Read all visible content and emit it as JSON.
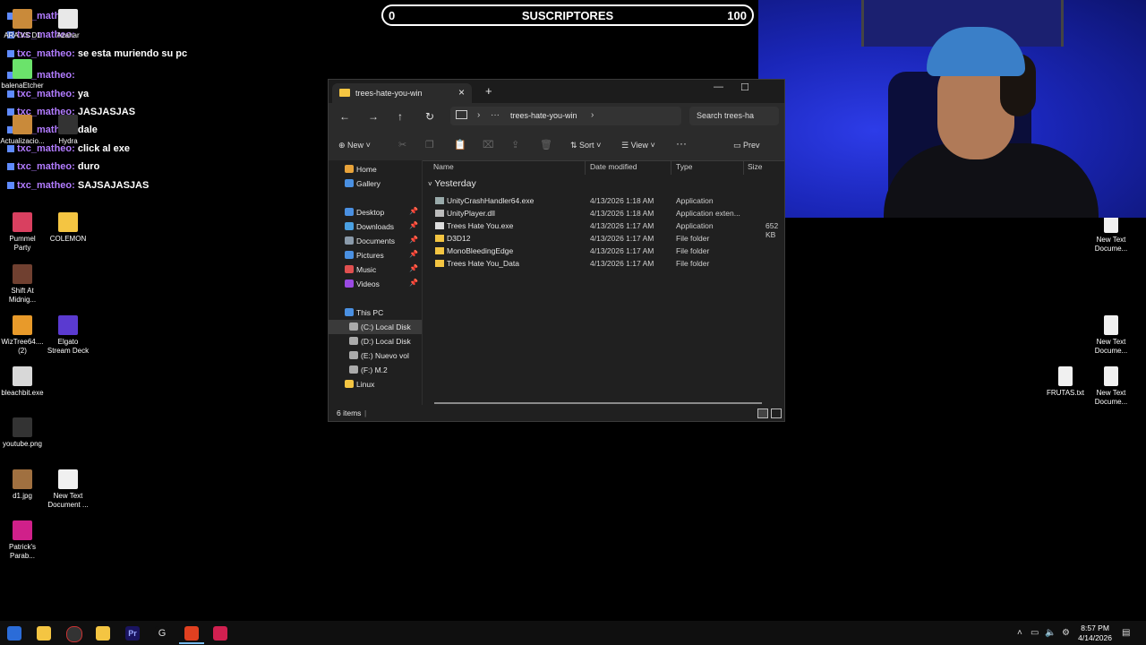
{
  "subscriber_bar": {
    "left_value": "0",
    "label": "SUSCRIPTORES",
    "right_value": "100"
  },
  "chat": [
    {
      "user": "txc_matheo:",
      "message": ""
    },
    {
      "user": "txc_matheo:",
      "message": ""
    },
    {
      "user": "txc_matheo:",
      "message": "se esta muriendo su pc"
    },
    {
      "user": "txc_matheo:",
      "message": ""
    },
    {
      "user": "txc_matheo:",
      "message": "ya"
    },
    {
      "user": "txc_matheo:",
      "message": "JASJASJAS"
    },
    {
      "user": "txc_matheo:",
      "message": "dale"
    },
    {
      "user": "txc_matheo:",
      "message": "click al exe"
    },
    {
      "user": "txc_matheo:",
      "message": "duro"
    },
    {
      "user": "txc_matheo:",
      "message": "SAJSAJASJAS"
    }
  ],
  "desktop_icons_left": [
    {
      "label": "ARA VS D1",
      "icon": "image-icon",
      "color": "#c98a3a"
    },
    {
      "label": "Azahar",
      "icon": "azahar-icon",
      "color": "#e8e8e8"
    },
    {
      "label": "balenaEtcher",
      "icon": "balena-icon",
      "color": "#6be36b"
    },
    {
      "label": "Actualizacio...",
      "icon": "update-icon",
      "color": "#c98a3a"
    },
    {
      "label": "Hydra",
      "icon": "hydra-icon",
      "color": "#333333"
    },
    {
      "label": "Pummel Party",
      "icon": "pummel-icon",
      "color": "#d94060"
    },
    {
      "label": "COLEMON",
      "icon": "folder-icon",
      "color": "#f4c542"
    },
    {
      "label": "Shift At Midnig...",
      "icon": "game-icon",
      "color": "#704030"
    },
    {
      "label": "WizTree64.... (2)",
      "icon": "wiztree-icon",
      "color": "#e89a2a"
    },
    {
      "label": "Elgato Stream Deck",
      "icon": "streamdeck-icon",
      "color": "#5a3ad0"
    },
    {
      "label": "bleachbit.exe",
      "icon": "bleachbit-icon",
      "color": "#d8d8d8"
    },
    {
      "label": "youtube.png",
      "icon": "image-icon",
      "color": "#333333"
    },
    {
      "label": "d1.jpg",
      "icon": "image-icon",
      "color": "#a07040"
    },
    {
      "label": "New Text Document ...",
      "icon": "text-file-icon",
      "color": "#f0f0f0"
    },
    {
      "label": "Patrick's Parab...",
      "icon": "game-icon",
      "color": "#d0208a"
    }
  ],
  "desktop_icons_right": [
    {
      "label": "New Text Docume..."
    },
    {
      "label": "New Text Docume..."
    },
    {
      "label": "FRUTAS.txt"
    },
    {
      "label": "New Text Docume..."
    }
  ],
  "explorer": {
    "tab_title": "trees-hate-you-win",
    "breadcrumb_more": "···",
    "breadcrumb": "trees-hate-you-win",
    "search_placeholder": "Search trees-ha",
    "toolbar": {
      "new": "New",
      "sort": "Sort",
      "view": "View",
      "more": "···",
      "preview": "Prev"
    },
    "sidebar": [
      {
        "label": "Home",
        "color": "#e8a33a"
      },
      {
        "label": "Gallery",
        "color": "#4a90e2"
      },
      {
        "label": "Desktop",
        "color": "#4a90e2"
      },
      {
        "label": "Downloads",
        "color": "#4aa0e2"
      },
      {
        "label": "Documents",
        "color": "#8a9aaa"
      },
      {
        "label": "Pictures",
        "color": "#4a90e2"
      },
      {
        "label": "Music",
        "color": "#e05050"
      },
      {
        "label": "Videos",
        "color": "#9a4ae2"
      },
      {
        "label": "This PC",
        "color": "#4a90e2"
      },
      {
        "label": "(C:) Local Disk",
        "color": "#aaaaaa"
      },
      {
        "label": "(D:) Local Disk",
        "color": "#aaaaaa"
      },
      {
        "label": "(E:) Nuevo vol",
        "color": "#aaaaaa"
      },
      {
        "label": "(F:) M.2",
        "color": "#aaaaaa"
      },
      {
        "label": "Linux",
        "color": "#f4c542"
      }
    ],
    "columns": {
      "name": "Name",
      "date": "Date modified",
      "type": "Type",
      "size": "Size"
    },
    "group": "Yesterday",
    "files": [
      {
        "name": "UnityCrashHandler64.exe",
        "date": "4/13/2026 1:18 AM",
        "type": "Application",
        "size": "",
        "icon": "exe-icon"
      },
      {
        "name": "UnityPlayer.dll",
        "date": "4/13/2026 1:18 AM",
        "type": "Application exten...",
        "size": "",
        "icon": "dll-icon"
      },
      {
        "name": "Trees Hate You.exe",
        "date": "4/13/2026 1:17 AM",
        "type": "Application",
        "size": "652 KB",
        "icon": "tree-icon"
      },
      {
        "name": "D3D12",
        "date": "4/13/2026 1:17 AM",
        "type": "File folder",
        "size": "",
        "icon": "folder-icon"
      },
      {
        "name": "MonoBleedingEdge",
        "date": "4/13/2026 1:17 AM",
        "type": "File folder",
        "size": "",
        "icon": "folder-icon"
      },
      {
        "name": "Trees Hate You_Data",
        "date": "4/13/2026 1:17 AM",
        "type": "File folder",
        "size": "",
        "icon": "folder-icon"
      }
    ],
    "status": "6 items"
  },
  "taskbar": {
    "clock_time": "8:57 PM",
    "clock_date": "4/14/2026"
  }
}
